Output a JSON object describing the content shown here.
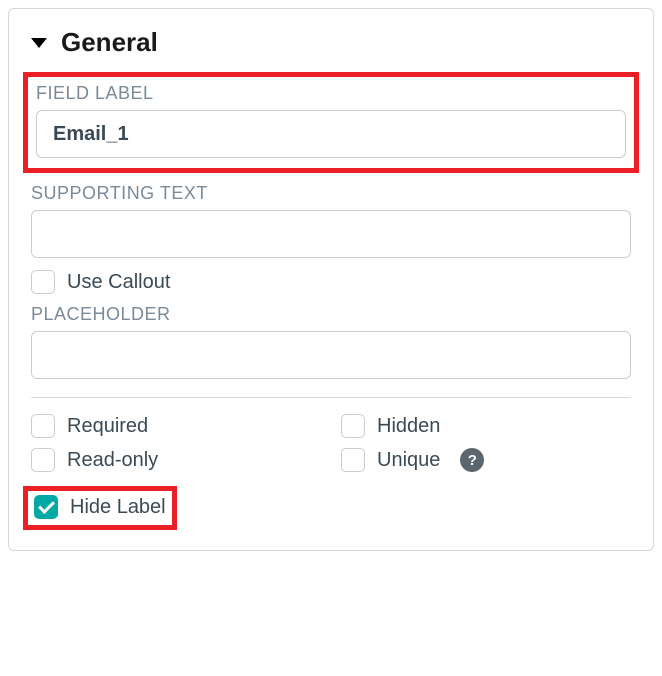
{
  "section": {
    "title": "General"
  },
  "fields": {
    "field_label": {
      "label": "FIELD LABEL",
      "value": "Email_1"
    },
    "supporting_text": {
      "label": "SUPPORTING TEXT",
      "value": ""
    },
    "use_callout": {
      "label": "Use Callout",
      "checked": false
    },
    "placeholder": {
      "label": "PLACEHOLDER",
      "value": ""
    }
  },
  "options": {
    "required": {
      "label": "Required",
      "checked": false
    },
    "hidden": {
      "label": "Hidden",
      "checked": false
    },
    "readonly": {
      "label": "Read-only",
      "checked": false
    },
    "unique": {
      "label": "Unique",
      "checked": false
    },
    "hide_label": {
      "label": "Hide Label",
      "checked": true
    }
  },
  "help_tooltip": "?"
}
